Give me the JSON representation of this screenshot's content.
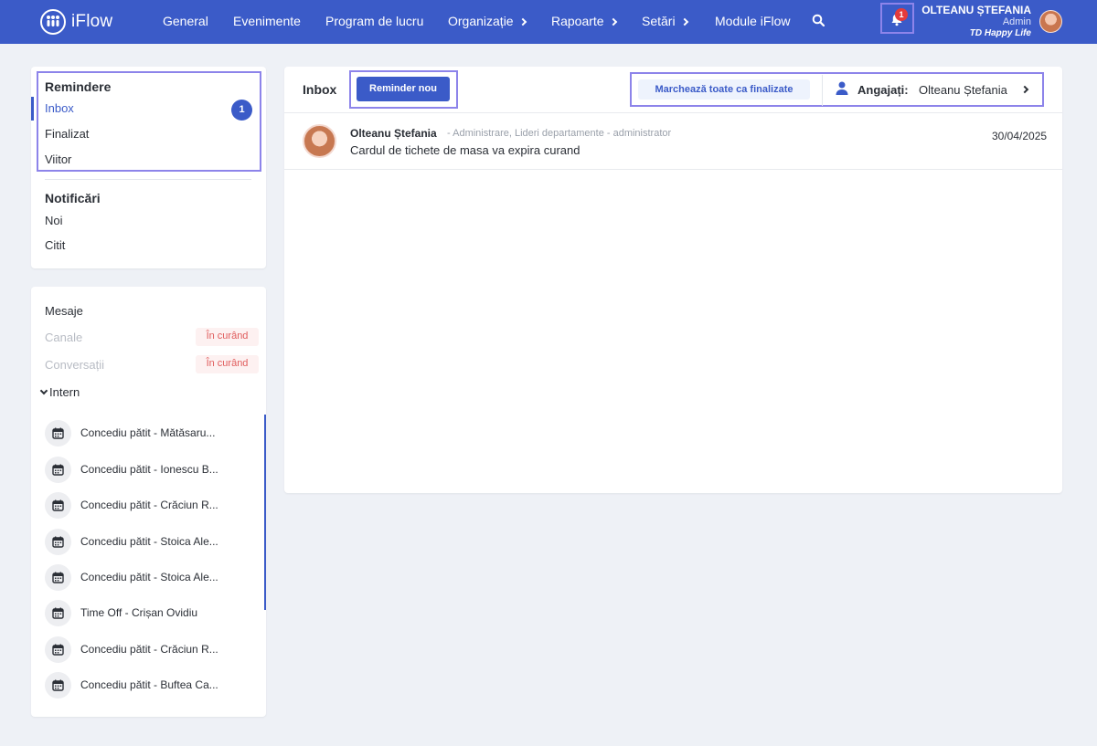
{
  "app": {
    "name": "iFlow"
  },
  "nav": {
    "items": [
      {
        "label": "General",
        "has_submenu": false
      },
      {
        "label": "Evenimente",
        "has_submenu": false
      },
      {
        "label": "Program de lucru",
        "has_submenu": false
      },
      {
        "label": "Organizație",
        "has_submenu": true
      },
      {
        "label": "Rapoarte",
        "has_submenu": true
      },
      {
        "label": "Setări",
        "has_submenu": true
      },
      {
        "label": "Module iFlow",
        "has_submenu": false
      }
    ],
    "search_icon": "search-icon"
  },
  "header_user": {
    "notification_count": "1",
    "name": "OLTEANU ȘTEFANIA",
    "role": "Admin",
    "company": "TD Happy Life"
  },
  "reminders": {
    "title": "Remindere",
    "items": [
      {
        "label": "Inbox",
        "active": true,
        "count": "1"
      },
      {
        "label": "Finalizat"
      },
      {
        "label": "Viitor"
      }
    ]
  },
  "notifications": {
    "title": "Notificări",
    "items": [
      {
        "label": "Noi"
      },
      {
        "label": "Citit"
      }
    ]
  },
  "messages": {
    "title": "Mesaje",
    "channels_label": "Canale",
    "conversations_label": "Conversații",
    "soon_label": "În curând",
    "intern_label": "Intern",
    "conversations": [
      "Concediu pătit - Mătăsaru...",
      "Concediu pătit - Ionescu B...",
      "Concediu pătit - Crăciun R...",
      "Concediu pătit - Stoica Ale...",
      "Concediu pătit - Stoica Ale...",
      "Time Off - Crișan Ovidiu",
      "Concediu pătit - Crăciun R...",
      "Concediu pătit - Buftea Ca..."
    ]
  },
  "main": {
    "inbox_title": "Inbox",
    "new_reminder_label": "Reminder nou",
    "mark_all_label": "Marchează toate ca finalizate",
    "employee_label": "Angajați:",
    "employee_value": "Olteanu Ștefania",
    "rows": [
      {
        "author": "Olteanu Ștefania",
        "meta": "- Administrare, Lideri departamente - administrator",
        "text": "Cardul de tichete de masa va expira curand",
        "date": "30/04/2025"
      }
    ]
  },
  "colors": {
    "brand": "#3b5bc8",
    "highlight": "#8d84ea",
    "badge_red": "#e43b3b",
    "soon_red": "#e05c5c"
  }
}
